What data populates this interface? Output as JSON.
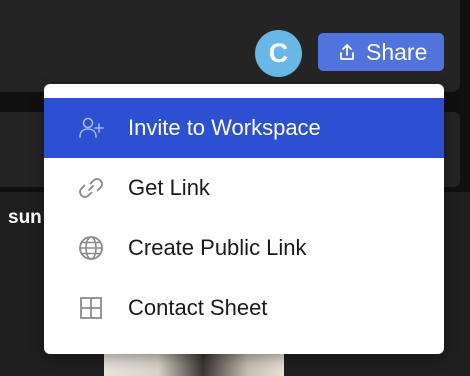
{
  "header": {
    "avatar_letter": "C",
    "share_label": "Share"
  },
  "content": {
    "partial_text": "sun"
  },
  "menu": {
    "items": [
      {
        "label": "Invite to Workspace",
        "icon": "add-user-icon",
        "active": true
      },
      {
        "label": "Get Link",
        "icon": "link-icon",
        "active": false
      },
      {
        "label": "Create Public Link",
        "icon": "globe-icon",
        "active": false
      },
      {
        "label": "Contact Sheet",
        "icon": "grid-icon",
        "active": false
      }
    ]
  },
  "colors": {
    "accent": "#5073de",
    "menu_highlight": "#2d50d2",
    "avatar": "#6ab6e5"
  }
}
